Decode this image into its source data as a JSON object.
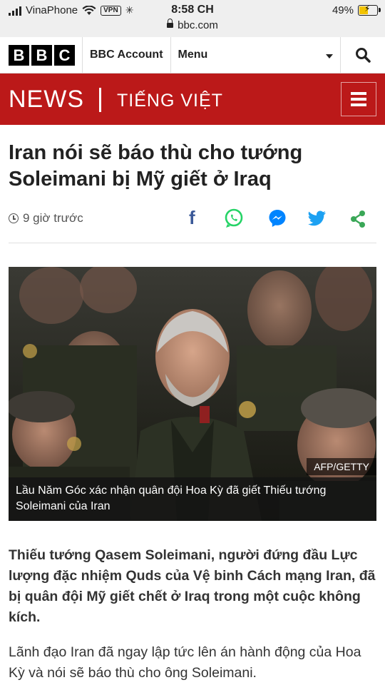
{
  "status_bar": {
    "carrier": "VinaPhone",
    "vpn": "VPN",
    "time": "8:58 CH",
    "url": "bbc.com",
    "battery": "49%"
  },
  "bbc_bar": {
    "logo": [
      "B",
      "B",
      "C"
    ],
    "account_label": "BBC Account",
    "menu_label": "Menu"
  },
  "news_bar": {
    "news": "NEWS",
    "language": "TIẾNG VIỆT"
  },
  "article": {
    "headline": "Iran nói sẽ báo thù cho tướng Soleimani bị Mỹ giết ở Iraq",
    "timestamp": "9 giờ trước",
    "image_credit": "AFP/GETTY",
    "image_caption": "Lầu Năm Góc xác nhận quân đội Hoa Kỳ đã giết Thiếu tướng Soleimani của Iran",
    "lead": "Thiếu tướng Qasem Soleimani, người đứng đầu Lực lượng đặc nhiệm Quds của Vệ binh Cách mạng Iran, đã bị quân đội Mỹ giết chết ở Iraq trong một cuộc không kích.",
    "paragraph": "Lãnh đạo Iran đã ngay lập tức lên án hành động của Hoa Kỳ và nói sẽ báo thù cho ông Soleimani."
  },
  "colors": {
    "news_red": "#bb1919",
    "facebook": "#3b5998",
    "whatsapp": "#25d366",
    "messenger": "#0084ff",
    "twitter": "#1da1f2",
    "share": "#3aa757"
  }
}
